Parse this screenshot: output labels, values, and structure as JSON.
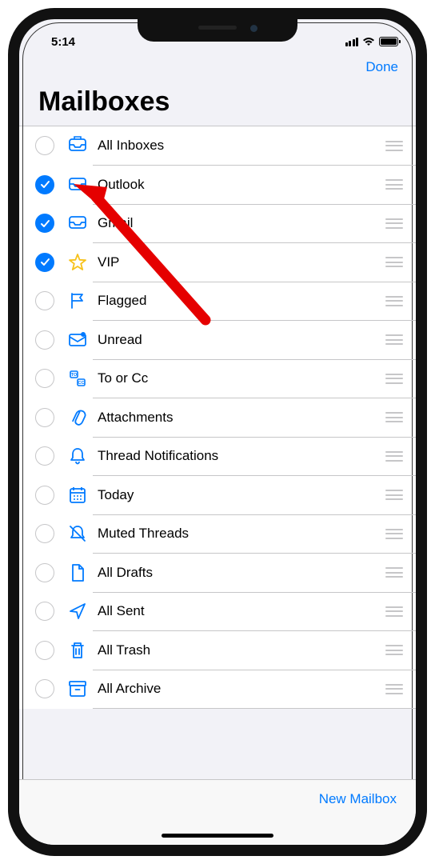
{
  "status": {
    "time": "5:14"
  },
  "nav": {
    "done": "Done"
  },
  "page": {
    "title": "Mailboxes"
  },
  "rows": [
    {
      "label": "All Inboxes",
      "checked": false,
      "icon": "all-inboxes"
    },
    {
      "label": "Outlook",
      "checked": true,
      "icon": "inbox"
    },
    {
      "label": "Gmail",
      "checked": true,
      "icon": "inbox"
    },
    {
      "label": "VIP",
      "checked": true,
      "icon": "star"
    },
    {
      "label": "Flagged",
      "checked": false,
      "icon": "flag"
    },
    {
      "label": "Unread",
      "checked": false,
      "icon": "unread"
    },
    {
      "label": "To or Cc",
      "checked": false,
      "icon": "tocc"
    },
    {
      "label": "Attachments",
      "checked": false,
      "icon": "paperclip"
    },
    {
      "label": "Thread Notifications",
      "checked": false,
      "icon": "bell"
    },
    {
      "label": "Today",
      "checked": false,
      "icon": "calendar"
    },
    {
      "label": "Muted Threads",
      "checked": false,
      "icon": "bell-slash"
    },
    {
      "label": "All Drafts",
      "checked": false,
      "icon": "draft"
    },
    {
      "label": "All Sent",
      "checked": false,
      "icon": "sent"
    },
    {
      "label": "All Trash",
      "checked": false,
      "icon": "trash"
    },
    {
      "label": "All Archive",
      "checked": false,
      "icon": "archive"
    }
  ],
  "toolbar": {
    "newMailbox": "New Mailbox"
  }
}
